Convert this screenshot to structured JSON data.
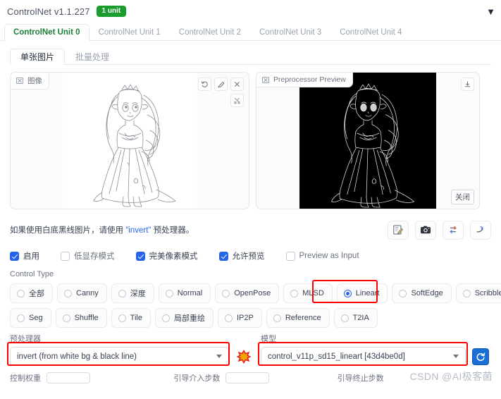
{
  "header": {
    "title": "ControlNet v1.1.227",
    "badge": "1 unit",
    "caret_icon": "triangle-down-icon"
  },
  "unit_tabs": [
    {
      "label": "ControlNet Unit 0",
      "active": true
    },
    {
      "label": "ControlNet Unit 1",
      "active": false
    },
    {
      "label": "ControlNet Unit 2",
      "active": false
    },
    {
      "label": "ControlNet Unit 3",
      "active": false
    },
    {
      "label": "ControlNet Unit 4",
      "active": false
    }
  ],
  "inner_tabs": [
    {
      "label": "单张图片",
      "active": true
    },
    {
      "label": "批量处理",
      "active": false
    }
  ],
  "image_panel": {
    "tag": "图像",
    "tools": [
      "undo-icon",
      "eraser-icon",
      "close-icon"
    ],
    "tools_secondary": [
      "scissors-icon"
    ]
  },
  "preview_panel": {
    "tag": "Preprocessor Preview",
    "download_icon": "download-icon",
    "close_label": "关闭"
  },
  "hint": {
    "text_before": "如果使用白底黑线图片，请使用 ",
    "quoted": "\"invert\"",
    "text_after": " 预处理器。"
  },
  "tool_buttons": [
    {
      "name": "edit-note-icon"
    },
    {
      "name": "camera-icon"
    },
    {
      "name": "swap-arrows-icon"
    },
    {
      "name": "pin-arrow-icon"
    }
  ],
  "checkboxes": [
    {
      "label": "启用",
      "checked": true
    },
    {
      "label": "低显存模式",
      "checked": false
    },
    {
      "label": "完美像素模式",
      "checked": true
    },
    {
      "label": "允许预览",
      "checked": true
    },
    {
      "label": "Preview as Input",
      "checked": false
    }
  ],
  "control_type": {
    "title": "Control Type",
    "row1": [
      {
        "label": "全部",
        "selected": false
      },
      {
        "label": "Canny",
        "selected": false
      },
      {
        "label": "深度",
        "selected": false
      },
      {
        "label": "Normal",
        "selected": false
      },
      {
        "label": "OpenPose",
        "selected": false
      },
      {
        "label": "MLSD",
        "selected": false
      },
      {
        "label": "Lineart",
        "selected": true
      },
      {
        "label": "SoftEdge",
        "selected": false
      },
      {
        "label": "Scribble",
        "selected": false
      }
    ],
    "row2": [
      {
        "label": "Seg",
        "selected": false
      },
      {
        "label": "Shuffle",
        "selected": false
      },
      {
        "label": "Tile",
        "selected": false
      },
      {
        "label": "局部重绘",
        "selected": false
      },
      {
        "label": "IP2P",
        "selected": false
      },
      {
        "label": "Reference",
        "selected": false
      },
      {
        "label": "T2IA",
        "selected": false
      }
    ]
  },
  "preprocessor": {
    "label": "预处理器",
    "value": "invert (from white bg & black line)",
    "action_icon": "explosion-icon"
  },
  "model": {
    "label": "模型",
    "value": "control_v11p_sd15_lineart [43d4be0d]",
    "action_icon": "refresh-icon"
  },
  "sliders": [
    {
      "label": "控制权重"
    },
    {
      "label": "引导介入步数"
    },
    {
      "label": "引导终止步数"
    }
  ],
  "watermark": "CSDN @AI极客菌",
  "colors": {
    "accent_blue": "#2563eb",
    "badge_green": "#1a9c2e",
    "active_tab_green": "#1a7f37",
    "highlight_red": "#ff0000"
  }
}
